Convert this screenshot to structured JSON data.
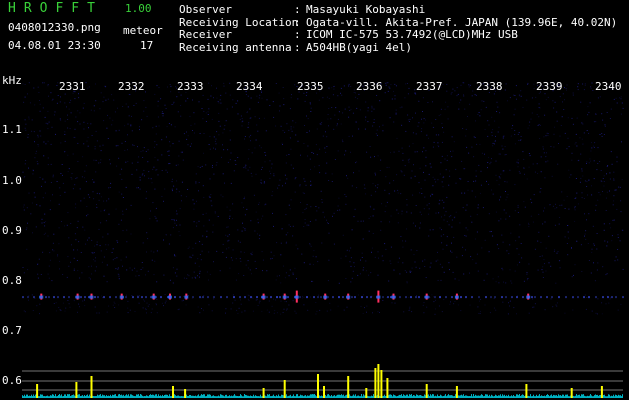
{
  "header": {
    "app_name": "HROFFT",
    "version": "1.00",
    "filename": "0408012330.png",
    "meteor_label": "meteor",
    "meteor_count": "17",
    "datetime": "04.08.01 23:30"
  },
  "station_info": [
    {
      "label": "Observer",
      "value": "Masayuki Kobayashi"
    },
    {
      "label": "Receiving Location",
      "value": "Ogata-vill. Akita-Pref. JAPAN (139.96E, 40.02N)"
    },
    {
      "label": "Receiver",
      "value": "ICOM IC-575 53.7492(@LCD)MHz USB"
    },
    {
      "label": "Receiving antenna",
      "value": "A504HB(yagi 4el)"
    }
  ],
  "chart_data": {
    "type": "heatmap",
    "title": "",
    "ylabel": "kHz",
    "xlabel": "",
    "x_ticks": [
      "2331",
      "2332",
      "2333",
      "2334",
      "2335",
      "2336",
      "2337",
      "2338",
      "2339",
      "2340"
    ],
    "y_ticks": [
      "1.1",
      "1.0",
      "0.9",
      "0.8",
      "0.7",
      "0.6"
    ],
    "ylim": [
      0.57,
      1.17
    ],
    "echo_band_khz": 0.765,
    "echo_x_minutes": [
      2330.72,
      2331.32,
      2331.55,
      2332.05,
      2332.58,
      2332.85,
      2333.12,
      2334.4,
      2334.75,
      2334.95,
      2335.42,
      2335.8,
      2336.3,
      2336.55,
      2337.1,
      2337.6,
      2338.78
    ],
    "colors": {
      "background": "#000000",
      "noise": "#1e1e8a",
      "echo": "#ff3060",
      "spectrum": "#ffff00",
      "baseline": "#00b0c0",
      "text_app": "#39d139"
    }
  }
}
